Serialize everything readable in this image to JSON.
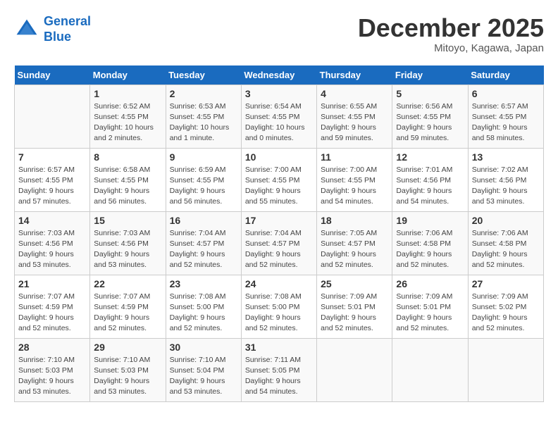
{
  "header": {
    "logo_line1": "General",
    "logo_line2": "Blue",
    "month": "December 2025",
    "location": "Mitoyo, Kagawa, Japan"
  },
  "weekdays": [
    "Sunday",
    "Monday",
    "Tuesday",
    "Wednesday",
    "Thursday",
    "Friday",
    "Saturday"
  ],
  "weeks": [
    [
      {
        "day": "",
        "sunrise": "",
        "sunset": "",
        "daylight": ""
      },
      {
        "day": "1",
        "sunrise": "Sunrise: 6:52 AM",
        "sunset": "Sunset: 4:55 PM",
        "daylight": "Daylight: 10 hours and 2 minutes."
      },
      {
        "day": "2",
        "sunrise": "Sunrise: 6:53 AM",
        "sunset": "Sunset: 4:55 PM",
        "daylight": "Daylight: 10 hours and 1 minute."
      },
      {
        "day": "3",
        "sunrise": "Sunrise: 6:54 AM",
        "sunset": "Sunset: 4:55 PM",
        "daylight": "Daylight: 10 hours and 0 minutes."
      },
      {
        "day": "4",
        "sunrise": "Sunrise: 6:55 AM",
        "sunset": "Sunset: 4:55 PM",
        "daylight": "Daylight: 9 hours and 59 minutes."
      },
      {
        "day": "5",
        "sunrise": "Sunrise: 6:56 AM",
        "sunset": "Sunset: 4:55 PM",
        "daylight": "Daylight: 9 hours and 59 minutes."
      },
      {
        "day": "6",
        "sunrise": "Sunrise: 6:57 AM",
        "sunset": "Sunset: 4:55 PM",
        "daylight": "Daylight: 9 hours and 58 minutes."
      }
    ],
    [
      {
        "day": "7",
        "sunrise": "Sunrise: 6:57 AM",
        "sunset": "Sunset: 4:55 PM",
        "daylight": "Daylight: 9 hours and 57 minutes."
      },
      {
        "day": "8",
        "sunrise": "Sunrise: 6:58 AM",
        "sunset": "Sunset: 4:55 PM",
        "daylight": "Daylight: 9 hours and 56 minutes."
      },
      {
        "day": "9",
        "sunrise": "Sunrise: 6:59 AM",
        "sunset": "Sunset: 4:55 PM",
        "daylight": "Daylight: 9 hours and 56 minutes."
      },
      {
        "day": "10",
        "sunrise": "Sunrise: 7:00 AM",
        "sunset": "Sunset: 4:55 PM",
        "daylight": "Daylight: 9 hours and 55 minutes."
      },
      {
        "day": "11",
        "sunrise": "Sunrise: 7:00 AM",
        "sunset": "Sunset: 4:55 PM",
        "daylight": "Daylight: 9 hours and 54 minutes."
      },
      {
        "day": "12",
        "sunrise": "Sunrise: 7:01 AM",
        "sunset": "Sunset: 4:56 PM",
        "daylight": "Daylight: 9 hours and 54 minutes."
      },
      {
        "day": "13",
        "sunrise": "Sunrise: 7:02 AM",
        "sunset": "Sunset: 4:56 PM",
        "daylight": "Daylight: 9 hours and 53 minutes."
      }
    ],
    [
      {
        "day": "14",
        "sunrise": "Sunrise: 7:03 AM",
        "sunset": "Sunset: 4:56 PM",
        "daylight": "Daylight: 9 hours and 53 minutes."
      },
      {
        "day": "15",
        "sunrise": "Sunrise: 7:03 AM",
        "sunset": "Sunset: 4:56 PM",
        "daylight": "Daylight: 9 hours and 53 minutes."
      },
      {
        "day": "16",
        "sunrise": "Sunrise: 7:04 AM",
        "sunset": "Sunset: 4:57 PM",
        "daylight": "Daylight: 9 hours and 52 minutes."
      },
      {
        "day": "17",
        "sunrise": "Sunrise: 7:04 AM",
        "sunset": "Sunset: 4:57 PM",
        "daylight": "Daylight: 9 hours and 52 minutes."
      },
      {
        "day": "18",
        "sunrise": "Sunrise: 7:05 AM",
        "sunset": "Sunset: 4:57 PM",
        "daylight": "Daylight: 9 hours and 52 minutes."
      },
      {
        "day": "19",
        "sunrise": "Sunrise: 7:06 AM",
        "sunset": "Sunset: 4:58 PM",
        "daylight": "Daylight: 9 hours and 52 minutes."
      },
      {
        "day": "20",
        "sunrise": "Sunrise: 7:06 AM",
        "sunset": "Sunset: 4:58 PM",
        "daylight": "Daylight: 9 hours and 52 minutes."
      }
    ],
    [
      {
        "day": "21",
        "sunrise": "Sunrise: 7:07 AM",
        "sunset": "Sunset: 4:59 PM",
        "daylight": "Daylight: 9 hours and 52 minutes."
      },
      {
        "day": "22",
        "sunrise": "Sunrise: 7:07 AM",
        "sunset": "Sunset: 4:59 PM",
        "daylight": "Daylight: 9 hours and 52 minutes."
      },
      {
        "day": "23",
        "sunrise": "Sunrise: 7:08 AM",
        "sunset": "Sunset: 5:00 PM",
        "daylight": "Daylight: 9 hours and 52 minutes."
      },
      {
        "day": "24",
        "sunrise": "Sunrise: 7:08 AM",
        "sunset": "Sunset: 5:00 PM",
        "daylight": "Daylight: 9 hours and 52 minutes."
      },
      {
        "day": "25",
        "sunrise": "Sunrise: 7:09 AM",
        "sunset": "Sunset: 5:01 PM",
        "daylight": "Daylight: 9 hours and 52 minutes."
      },
      {
        "day": "26",
        "sunrise": "Sunrise: 7:09 AM",
        "sunset": "Sunset: 5:01 PM",
        "daylight": "Daylight: 9 hours and 52 minutes."
      },
      {
        "day": "27",
        "sunrise": "Sunrise: 7:09 AM",
        "sunset": "Sunset: 5:02 PM",
        "daylight": "Daylight: 9 hours and 52 minutes."
      }
    ],
    [
      {
        "day": "28",
        "sunrise": "Sunrise: 7:10 AM",
        "sunset": "Sunset: 5:03 PM",
        "daylight": "Daylight: 9 hours and 53 minutes."
      },
      {
        "day": "29",
        "sunrise": "Sunrise: 7:10 AM",
        "sunset": "Sunset: 5:03 PM",
        "daylight": "Daylight: 9 hours and 53 minutes."
      },
      {
        "day": "30",
        "sunrise": "Sunrise: 7:10 AM",
        "sunset": "Sunset: 5:04 PM",
        "daylight": "Daylight: 9 hours and 53 minutes."
      },
      {
        "day": "31",
        "sunrise": "Sunrise: 7:11 AM",
        "sunset": "Sunset: 5:05 PM",
        "daylight": "Daylight: 9 hours and 54 minutes."
      },
      {
        "day": "",
        "sunrise": "",
        "sunset": "",
        "daylight": ""
      },
      {
        "day": "",
        "sunrise": "",
        "sunset": "",
        "daylight": ""
      },
      {
        "day": "",
        "sunrise": "",
        "sunset": "",
        "daylight": ""
      }
    ]
  ]
}
